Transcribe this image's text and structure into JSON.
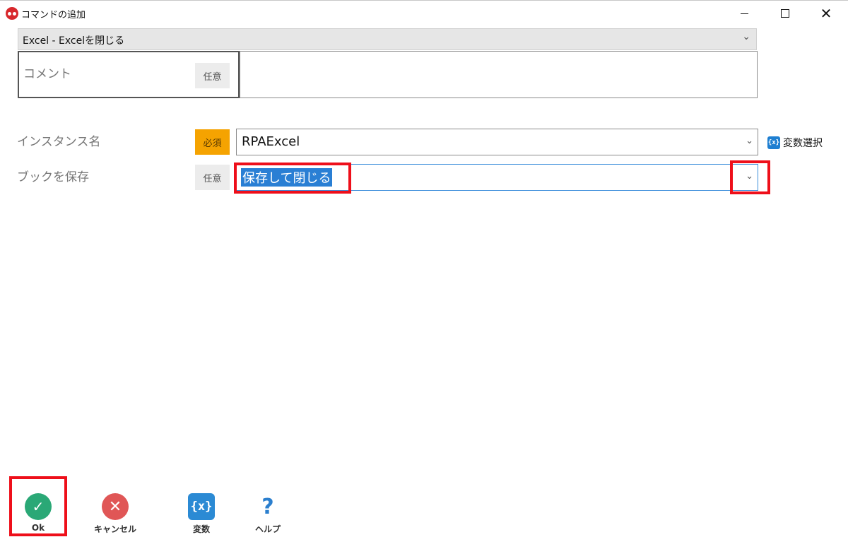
{
  "window": {
    "title": "コマンドの追加",
    "minimize_icon": "minimize-icon",
    "maximize_icon": "maximize-icon",
    "close_icon": "close-icon",
    "close_glyph": "✕"
  },
  "command_select": {
    "value": "Excel - Excelを閉じる",
    "chevron": "⌄"
  },
  "comment": {
    "label": "コメント",
    "badge": "任意",
    "value": ""
  },
  "fields": {
    "instance_name": {
      "label": "インスタンス名",
      "badge": "必須",
      "value": "RPAExcel",
      "chevron": "⌄"
    },
    "save_book": {
      "label": "ブックを保存",
      "badge": "任意",
      "value": "保存して閉じる",
      "chevron": "⌄"
    }
  },
  "variable_select": {
    "icon_text": "{x}",
    "label": "変数選択"
  },
  "toolbar": {
    "ok": {
      "label": "Ok",
      "glyph": "✓"
    },
    "cancel": {
      "label": "キャンセル",
      "glyph": "✕"
    },
    "variables": {
      "label": "変数",
      "glyph": "{x}"
    },
    "help": {
      "label": "ヘルプ",
      "glyph": "?"
    }
  },
  "colors": {
    "highlight": "#ee0f1a",
    "required_badge": "#f5a301",
    "ok": "#2aa876",
    "cancel": "#e05656",
    "accent": "#2b8ad4"
  }
}
